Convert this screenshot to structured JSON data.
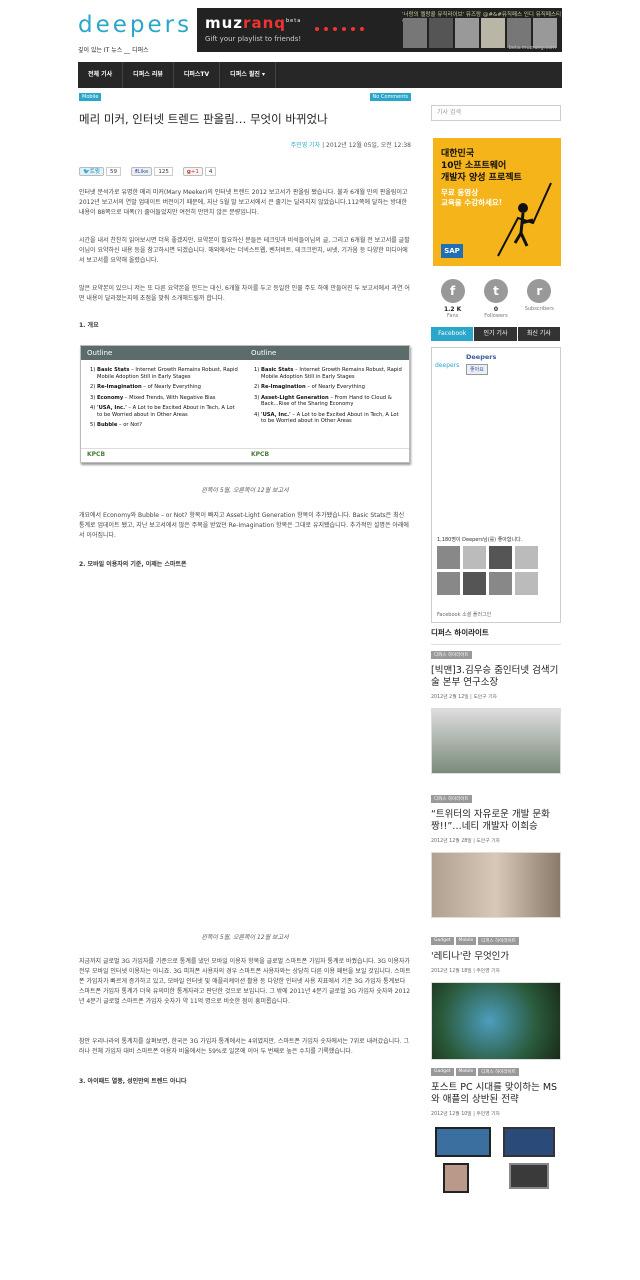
{
  "site": {
    "logo": "deepers",
    "tagline": "깊이 있는 IT 뉴스 __ 디퍼스"
  },
  "banner": {
    "brand_pre": "muz",
    "brand_accent": "ranq",
    "brand_sup": "beta",
    "slogan": "Gift your playlist to friends!",
    "quote": "'너랑의 멜랑콜 뮤직라이브' 뮤즈랑 @#&#뮤직페스 인디 뮤직페스티벌",
    "url": "beta.muzrang.com"
  },
  "nav": {
    "items": [
      "전체 기사",
      "디퍼스 리뷰",
      "디퍼스TV",
      "디퍼스 필진 ▾"
    ]
  },
  "article": {
    "category": "Mobile",
    "comments": "No Comments",
    "title": "메리 미커, 인터넷 트렌드 판올림… 무엇이 바뀌었나",
    "author": "주민영 기자",
    "date": "2012년 12월 05일, 오전 12:38",
    "share": {
      "tweet_label": "트윗",
      "tweet_count": "59",
      "like_label": "Like",
      "like_count": "125",
      "gplus_label": "+1",
      "gplus_count": "4"
    },
    "p1": "인터넷 분석가로 유명한 메리 미커(Mary Meeker)의 인터넷 트렌드 2012 보고서가 판올림 됐습니다. 불과 6개월 만의 판올림이고 2012년 보고서의 연말 업데이트 버전이기 때문에, 지난 5월 말 보고서에서 큰 줄기는 달라지지 않았습니다.112쪽에 달하는 방대한 내용이 88쪽으로 대폭(?) 줄어들었지만 여전히 만만치 않은 분량입니다.",
    "p2": "시간을 내서 찬찬히 읽어보시면 더욱 좋겠지만, 요약본이 필요하신 분들은 테크잇과 비석들이님의 글, 그리고 6개월 전 보고서를 글팔이님이 요약하신 내용 등을 참고하시면 되겠습니다. 해외에서는 더넥스트웹, 벤처비트, 테크크런치, 씨넷, 기가옴 등 다양한 미디어에서 보고서를 요약해 올렸습니다.",
    "p3": "많은 요약본이 있으니 저는 또 다른 요약본을 만드는 대신, 6개월 차이를 두고 등일한 인물 주도 하에 만들어진 두 보고서에서 과연 어떤 내용이 달라졌는지에 초점을 맞춰 소개해드릴까 합니다.",
    "s1": "1. 개요",
    "outline": {
      "left_header": "Outline",
      "right_header": "Outline",
      "left_items": [
        {
          "n": "1)",
          "b": "Basic Stats",
          "t": " – Internet Growth Remains Robust, Rapid Mobile Adoption Still in Early Stages"
        },
        {
          "n": "2)",
          "b": "Re-Imagination",
          "t": " – of Nearly Everything"
        },
        {
          "n": "3)",
          "b": "Economy",
          "t": " – Mixed Trends, With Negative Bias"
        },
        {
          "n": "4)",
          "b": "'USA, Inc.'",
          "t": " – A Lot to be Excited About in Tech, A Lot to be Worried about in Other Areas"
        },
        {
          "n": "5)",
          "b": "Bubble",
          "t": " – or Not?"
        }
      ],
      "right_items": [
        {
          "n": "1)",
          "b": "Basic Stats",
          "t": " – Internet Growth Remains Robust, Rapid Mobile Adoption Still in Early Stages"
        },
        {
          "n": "2)",
          "b": "Re-Imagination",
          "t": " – of Nearly Everything"
        },
        {
          "n": "3)",
          "b": "Asset-Light Generation",
          "t": " – From Hand to Cloud & Back...Rise of the Sharing Economy"
        },
        {
          "n": "4)",
          "b": "'USA, Inc.'",
          "t": " – A Lot to be Excited About in Tech, A Lot to be Worried about in Other Areas"
        }
      ],
      "footer_left": "KPCB",
      "footer_right": "KPCB"
    },
    "cap1": "왼쪽이 5월, 오른쪽이 12월 보고서",
    "p4": "개요에서 Economy와 Bubble – or Not? 항목이 빠지고 Asset-Light Generation 항목이 추가됐습니다. Basic Stats은 최신 통계로 업데이트 됐고, 지난 보고서에서 많은 주목을 받았던 Re-Imagination 항목은 그대로 유지됐습니다. 추가적인 설명은 아래에서 이어집니다.",
    "s2": "2. 모바일 이용자의 기준, 이제는 스마트폰",
    "cap2": "왼쪽이 5월, 오른쪽이 12월 보고서",
    "p5": "지금까지 글로벌 3G 가입자를 기준으로 통계를 냈던 모바일 이용자 항목을 글로벌 스마트폰 가입자 통계로 바꿨습니다. 3G 이용자가 전부 모바일 인터넷 이용자는 아니죠. 3G 피처폰 사용자의 경우 스마트폰 사용자와는 상당히 다른 이용 패턴을 보일 것입니다. 스마트폰 가입자가 빠르게 증가하고 있고, 모바일 인터넷 및 애플리케이션 활용 등 다양한 인터넷 사용 지표에서 기존 3G 가입자 통계보다 스마트폰 가입자 통계가 더욱 유의미한 통계자라고 판단한 것으로 보입니다. 그 밖에 2011년 4분기 글로벌 3G 가입자 숫자와 2012년 4분기 글로벌 스마트폰 가입자 숫자가 약 11억 명으로 비슷한 점이 흥미롭습니다.",
    "p6": "참안 우리나라의 통계치를 살펴보면, 한국은 3G 가입자 통계에서는 4위였지만, 스마트폰 가입자 숫자에서는 7위로 내려갔습니다. 그러나 전체 가입자 대비 스마트폰 이용자 비율에서는 59%로 일본에 이어 두 번째로 높은 수치를 기록했습니다.",
    "s3": "3. 아이패드 열풍, 성인만의 트렌드 아니다"
  },
  "sidebar": {
    "search_placeholder": "기사 검색",
    "sap": {
      "line1": "대한민국",
      "line2": "10만 소프트웨어",
      "line3": "개발자 양성 프로젝트",
      "line4": "무료 동영상",
      "line5": "교육을 수강하세요!",
      "logo": "SAP"
    },
    "social": [
      {
        "icon": "f",
        "count": "1.2 K",
        "label": "Fans"
      },
      {
        "icon": "t",
        "count": "0",
        "label": "Followers"
      },
      {
        "icon": "r",
        "count": "",
        "label": "Subscribers"
      }
    ],
    "tabs": [
      "Facebook",
      "인기 기사",
      "최신 기사"
    ],
    "fb": {
      "name": "Deepers",
      "logo": "deepers",
      "like": "좋아요",
      "count_text": "1,180명이 Deepers님(를) 좋아합니다.",
      "footer": "Facebook 소셜 플러그인"
    },
    "highlight_title": "디퍼스 하이라이트",
    "highlights": [
      {
        "tags": [
          "디퍼스 하이라이트"
        ],
        "title": "[빅맨]3.김우승 줌인터넷 검색기술 본부 연구소장",
        "date": "2012년 2월 12일 | 도안구 기자"
      },
      {
        "tags": [
          "디퍼스 하이라이트"
        ],
        "title": "“트위터의 자유로운 개발 문화 짱!!”…네티 개발자 이희승",
        "date": "2012년 12월 28일 | 도안구 기자"
      },
      {
        "tags": [
          "Gadget",
          "Mobile",
          "디퍼스 하이라이트"
        ],
        "title": "'레티나'란 무엇인가",
        "date": "2012년 12월 18일 | 주민영 기자"
      },
      {
        "tags": [
          "Gadget",
          "Mobile",
          "디퍼스 하이라이트"
        ],
        "title": "포스트 PC 시대를 맞이하는 MS와 애플의 상반된 전략",
        "date": "2012년 12월 10일 | 주민영 기자"
      }
    ]
  }
}
